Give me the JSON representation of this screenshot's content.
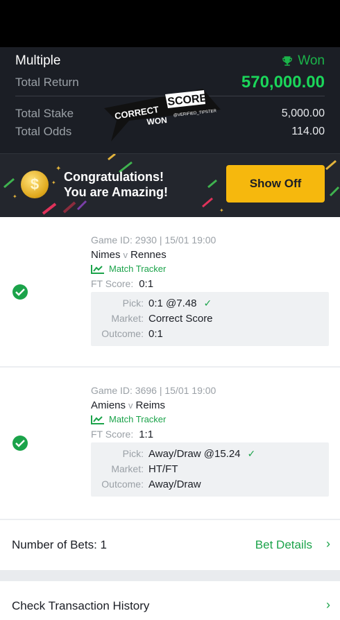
{
  "summary": {
    "title": "Multiple",
    "status": "Won",
    "total_return_label": "Total Return",
    "total_return": "570,000.00",
    "total_stake_label": "Total Stake",
    "total_stake": "5,000.00",
    "total_odds_label": "Total Odds",
    "total_odds": "114.00"
  },
  "watermark": {
    "line1": "CORRECT",
    "line2": "SCORE",
    "line3": "WON",
    "line4": "@VERIFIED_TIPSTER"
  },
  "banner": {
    "coin_symbol": "$",
    "line1": "Congratulations!",
    "line2": "You are Amazing!",
    "button": "Show Off"
  },
  "bets": [
    {
      "game_line": "Game ID: 2930 | 15/01 19:00",
      "home": "Nimes",
      "vs": "v",
      "away": "Rennes",
      "tracker": "Match Tracker",
      "ft_label": "FT Score:",
      "ft_score": "0:1",
      "pick_label": "Pick:",
      "pick": "0:1 @7.48",
      "market_label": "Market:",
      "market": "Correct Score",
      "outcome_label": "Outcome:",
      "outcome": "0:1"
    },
    {
      "game_line": "Game ID: 3696 | 15/01 19:00",
      "home": "Amiens",
      "vs": "v",
      "away": "Reims",
      "tracker": "Match Tracker",
      "ft_label": "FT Score:",
      "ft_score": "1:1",
      "pick_label": "Pick:",
      "pick": "Away/Draw @15.24",
      "market_label": "Market:",
      "market": "HT/FT",
      "outcome_label": "Outcome:",
      "outcome": "Away/Draw"
    }
  ],
  "footer": {
    "num_bets": "Number of Bets: 1",
    "bet_details": "Bet Details",
    "history": "Check Transaction History",
    "chevron": "›"
  },
  "colors": {
    "accent_green": "#1ba34a",
    "return_green": "#1bd65a",
    "button_yellow": "#f6b80d",
    "dark_bg": "#1b1e25"
  }
}
